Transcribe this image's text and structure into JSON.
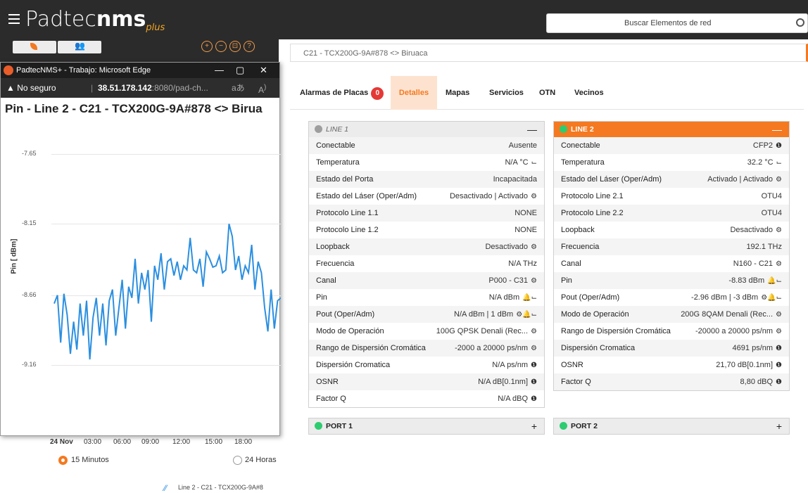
{
  "app": {
    "logo_main": "Padtec",
    "logo_bold": "nms",
    "logo_suffix": "plus",
    "search_placeholder": "Buscar Elementos de red"
  },
  "breadcrumb": "C21 - TCX200G-9A#878 <> Biruaca",
  "tabs": [
    {
      "label": "Alarmas de Placas",
      "badge": "0"
    },
    {
      "label": "Detalles"
    },
    {
      "label": "Mapas"
    },
    {
      "label": "Servicios"
    },
    {
      "label": "OTN"
    },
    {
      "label": "Vecinos"
    }
  ],
  "line1": {
    "title": "LINE 1",
    "rows": [
      {
        "k": "Conectable",
        "v": "Ausente"
      },
      {
        "k": "Temperatura",
        "v": "N/A °C"
      },
      {
        "k": "Estado del Porta",
        "v": "Incapacitada"
      },
      {
        "k": "Estado del Láser (Oper/Adm)",
        "v": "Desactivado | Activado"
      },
      {
        "k": "Protocolo Line 1.1",
        "v": "NONE"
      },
      {
        "k": "Protocolo Line 1.2",
        "v": "NONE"
      },
      {
        "k": "Loopback",
        "v": "Desactivado"
      },
      {
        "k": "Frecuencia",
        "v": "N/A THz"
      },
      {
        "k": "Canal",
        "v": "P000 - C31"
      },
      {
        "k": "Pin",
        "v": "N/A dBm"
      },
      {
        "k": "Pout (Oper/Adm)",
        "v": "N/A dBm | 1 dBm"
      },
      {
        "k": "Modo de Operación",
        "v": "100G QPSK Denali (Rec..."
      },
      {
        "k": "Rango de Dispersión Cromática",
        "v": "-2000 a 20000 ps/nm"
      },
      {
        "k": "Dispersión Cromatica",
        "v": "N/A ps/nm"
      },
      {
        "k": "OSNR",
        "v": "N/A dB[0.1nm]"
      },
      {
        "k": "Factor Q",
        "v": "N/A dBQ"
      }
    ]
  },
  "line2": {
    "title": "LINE 2",
    "rows": [
      {
        "k": "Conectable",
        "v": "CFP2"
      },
      {
        "k": "Temperatura",
        "v": "32.2 °C"
      },
      {
        "k": "Estado del Láser (Oper/Adm)",
        "v": "Activado | Activado"
      },
      {
        "k": "Protocolo Line 2.1",
        "v": "OTU4"
      },
      {
        "k": "Protocolo Line 2.2",
        "v": "OTU4"
      },
      {
        "k": "Loopback",
        "v": "Desactivado"
      },
      {
        "k": "Frecuencia",
        "v": "192.1 THz"
      },
      {
        "k": "Canal",
        "v": "N160 - C21"
      },
      {
        "k": "Pin",
        "v": "-8.83 dBm"
      },
      {
        "k": "Pout (Oper/Adm)",
        "v": "-2.96 dBm | -3 dBm"
      },
      {
        "k": "Modo de Operación",
        "v": "200G 8QAM Denali (Rec..."
      },
      {
        "k": "Rango de Dispersión Cromática",
        "v": "-20000 a 20000 ps/nm"
      },
      {
        "k": "Dispersión Cromatica",
        "v": "4691 ps/nm"
      },
      {
        "k": "OSNR",
        "v": "21,70 dB[0.1nm]"
      },
      {
        "k": "Factor Q",
        "v": "8,80 dBQ"
      }
    ]
  },
  "port1": {
    "title": "PORT 1"
  },
  "port2": {
    "title": "PORT 2"
  },
  "popup": {
    "window_title": "PadtecNMS+ - Trabajo: Microsoft Edge",
    "not_secure": "No seguro",
    "url_host": "38.51.178.142",
    "url_rest": ":8080/pad-ch...",
    "heading": "Pin - Line 2 - C21 - TCX200G-9A#878 <> Birua",
    "radio_left": "15 Minutos",
    "radio_right": "24 Horas",
    "legend": "Line 2 - C21 - TCX200G-9A#8"
  },
  "chart_data": {
    "type": "line",
    "ylabel": "Pin [ dBm]",
    "yticks": [
      "-7.65",
      "-8.15",
      "-8.66",
      "-9.16"
    ],
    "ylim": [
      -9.16,
      -7.65
    ],
    "xticks": [
      "24 Nov",
      "03:00",
      "06:00",
      "09:00",
      "12:00",
      "15:00",
      "18:00"
    ],
    "series": [
      {
        "name": "Line 2 - C21 - TCX200G-9A#8",
        "color": "#2b8fe0",
        "values": [
          -8.72,
          -8.66,
          -9.0,
          -8.65,
          -8.8,
          -9.08,
          -8.85,
          -9.05,
          -8.72,
          -8.95,
          -8.7,
          -9.12,
          -8.82,
          -8.68,
          -8.95,
          -8.72,
          -9.02,
          -8.7,
          -8.62,
          -8.95,
          -8.75,
          -8.55,
          -8.9,
          -8.6,
          -8.68,
          -8.4,
          -8.72,
          -8.5,
          -8.62,
          -8.48,
          -8.85,
          -8.45,
          -8.55,
          -8.36,
          -8.62,
          -8.42,
          -8.4,
          -8.52,
          -8.42,
          -8.55,
          -8.45,
          -8.48,
          -8.25,
          -8.48,
          -8.5,
          -8.4,
          -8.6,
          -8.35,
          -8.4,
          -8.46,
          -8.45,
          -8.38,
          -8.5,
          -8.48,
          -8.15,
          -8.24,
          -8.48,
          -8.38,
          -8.55,
          -8.45,
          -8.5,
          -8.3,
          -8.62,
          -8.42,
          -8.5,
          -8.75,
          -8.92,
          -8.62,
          -8.9,
          -8.7,
          -8.68
        ]
      }
    ]
  }
}
